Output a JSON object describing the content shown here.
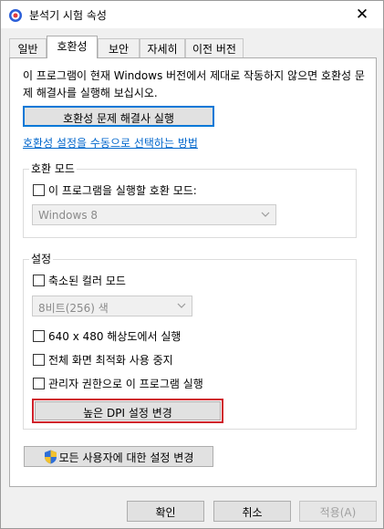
{
  "window": {
    "title": "분석기 시험 속성",
    "close_glyph": "✕"
  },
  "tabs": [
    "일반",
    "호환성",
    "보안",
    "자세히",
    "이전 버전"
  ],
  "compat": {
    "description": "이 프로그램이 현재 Windows 버전에서 제대로 작동하지 않으면 호환성 문제 해결사를 실행해 보십시오.",
    "troubleshooter_button": "호환성 문제 해결사 실행",
    "manual_link": "호환성 설정을 수동으로 선택하는 방법",
    "mode_group": {
      "label": "호환 모드",
      "checkbox_label": "이 프로그램을 실행할 호환 모드:",
      "checked": false,
      "select_value": "Windows 8"
    },
    "settings_group": {
      "label": "설정",
      "reduced_color": {
        "label": "축소된 컬러 모드",
        "checked": false
      },
      "color_select": "8비트(256) 색",
      "res_640": {
        "label": "640 x 480 해상도에서 실행",
        "checked": false
      },
      "disable_fullscreen": {
        "label": "전체 화면 최적화 사용 중지",
        "checked": false
      },
      "run_admin": {
        "label": "관리자 권한으로 이 프로그램 실행",
        "checked": false
      },
      "dpi_button": "높은 DPI 설정 변경"
    },
    "all_users_button": "모든 사용자에 대한 설정 변경"
  },
  "footer": {
    "ok": "확인",
    "cancel": "취소",
    "apply": "적용(A)"
  },
  "colors": {
    "link": "#0066cc",
    "focus": "#0078d7",
    "highlight": "#d0202a"
  }
}
